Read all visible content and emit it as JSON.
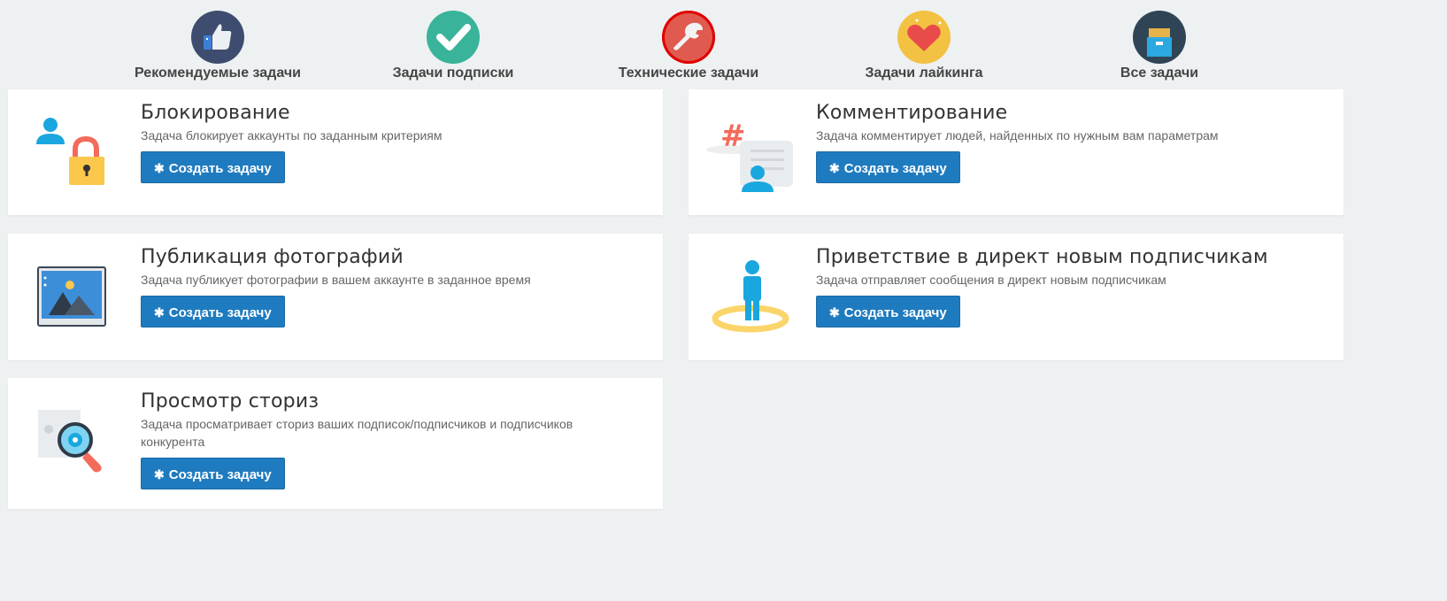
{
  "tabs": [
    {
      "label": "Рекомендуемые задачи",
      "icon": "thumbs-up-icon",
      "color": "#3e4c6f"
    },
    {
      "label": "Задачи подписки",
      "icon": "checkmark-icon",
      "color": "#39b49a"
    },
    {
      "label": "Технические задачи",
      "icon": "wrench-icon",
      "color": "#e05a4f",
      "active": true
    },
    {
      "label": "Задачи лайкинга",
      "icon": "heart-icon",
      "color": "#f3c243"
    },
    {
      "label": "Все задачи",
      "icon": "archive-box-icon",
      "color": "#2f4556"
    }
  ],
  "cards": [
    {
      "title": "Блокирование",
      "desc": "Задача блокирует аккаунты по заданным критериям",
      "button": "Создать задачу",
      "icon": "user-lock-icon"
    },
    {
      "title": "Комментирование",
      "desc": "Задача комментирует людей, найденных по нужным вам параметрам",
      "button": "Создать задачу",
      "icon": "hashtag-comment-icon"
    },
    {
      "title": "Публикация фотографий",
      "desc": "Задача публикует фотографии в вашем аккаунте в заданное время",
      "button": "Создать задачу",
      "icon": "photo-icon"
    },
    {
      "title": "Приветствие в директ новым подписчикам",
      "desc": "Задача отправляет сообщения в директ новым подписчикам",
      "button": "Создать задачу",
      "icon": "person-circle-icon"
    },
    {
      "title": "Просмотр сториз",
      "desc": "Задача просматривает сториз ваших подписок/подписчиков и подписчиков конкурента",
      "button": "Создать задачу",
      "icon": "magnifier-icon"
    }
  ],
  "colors": {
    "accent": "#1f7bbf",
    "background": "#eef1f2"
  }
}
